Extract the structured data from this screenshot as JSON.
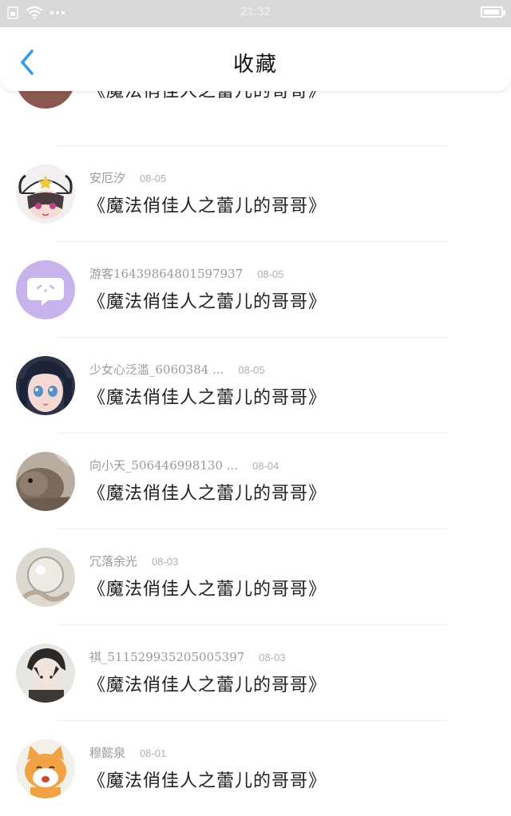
{
  "status_bar": {
    "time": "21:32",
    "icons": [
      "sim-icon",
      "wifi-icon",
      "more-dots-icon",
      "battery-icon"
    ]
  },
  "nav": {
    "title": "收藏",
    "back_icon": "chevron-left-icon",
    "accent": "#2f9be8"
  },
  "items": [
    {
      "user": "",
      "date": "",
      "content": "《魔法俏佳人之蕾儿的哥哥》",
      "avatar": "partial-portrait"
    },
    {
      "user": "安厄汐",
      "date": "08-05",
      "content": "《魔法俏佳人之蕾儿的哥哥》",
      "avatar": "anime-girl-cap"
    },
    {
      "user": "游客16439864801597937",
      "date": "08-05",
      "content": "《魔法俏佳人之蕾儿的哥哥》",
      "avatar": "chat-bubble-default"
    },
    {
      "user": "少女心泛滥_6060384 ...",
      "date": "08-05",
      "content": "《魔法俏佳人之蕾儿的哥哥》",
      "avatar": "anime-girl-dark-hair"
    },
    {
      "user": "向小天_506446998130 ...",
      "date": "08-04",
      "content": "《魔法俏佳人之蕾儿的哥哥》",
      "avatar": "rabbit-photo"
    },
    {
      "user": "冗落余光",
      "date": "08-03",
      "content": "《魔法俏佳人之蕾儿的哥哥》",
      "avatar": "glass-sphere-photo"
    },
    {
      "user": "祺_511529935205005397",
      "date": "08-03",
      "content": "《魔法俏佳人之蕾儿的哥哥》",
      "avatar": "anime-boy-sketch"
    },
    {
      "user": "穆懿泉",
      "date": "08-01",
      "content": "《魔法俏佳人之蕾儿的哥哥》",
      "avatar": "orange-cat-cartoon"
    }
  ]
}
